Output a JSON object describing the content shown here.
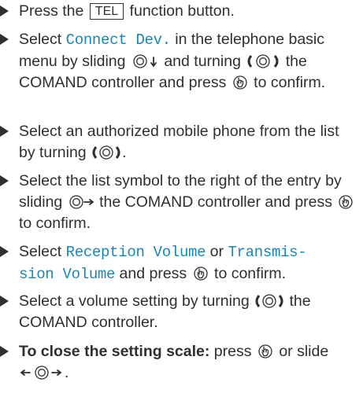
{
  "steps": [
    {
      "a": "Press the ",
      "key": "TEL",
      "b": " function button."
    },
    {
      "a": "Select ",
      "m1": "Connect Dev.",
      "b": " in the telephone basic menu by sliding",
      "c": " and turning",
      "d": " the COMAND controller and press",
      "e": " to confirm."
    },
    {
      "a": "Select an authorized mobile phone from the list by turning",
      "b": "."
    },
    {
      "a": "Select the list symbol to the right of the entry by sliding",
      "b": " the COMAND controller and press",
      "c": " to confirm."
    },
    {
      "a": "Select ",
      "m1": "Reception Volume",
      "b": " or ",
      "m2a": "Transmis-",
      "m2b": "sion Volume",
      "c": " and press",
      "d": " to confirm."
    },
    {
      "a": "Select a volume setting by turning",
      "b": " the COMAND controller."
    },
    {
      "bold": "To close the setting scale:",
      "a": " press",
      "b": " or slide",
      "c": "."
    }
  ],
  "icons": [
    "controller-press-icon",
    "controller-slide-down-icon",
    "controller-turn-icon",
    "controller-slide-right-icon",
    "controller-slide-left-right-icon"
  ]
}
